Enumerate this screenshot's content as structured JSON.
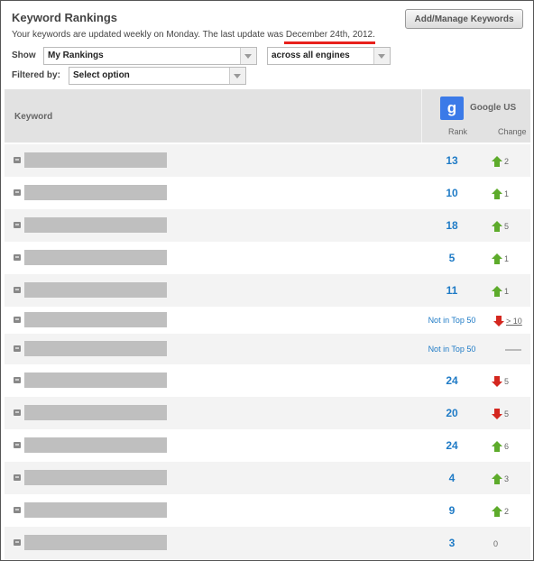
{
  "header": {
    "title": "Keyword Rankings",
    "subtitle_prefix": "Your keywords are updated weekly on Monday. The last update was ",
    "last_update": "December 24th, 2012",
    "subtitle_suffix": ".",
    "manage_button": "Add/Manage Keywords"
  },
  "filters": {
    "show_label": "Show",
    "show_value": "My Rankings",
    "engine_value": "across all engines",
    "filtered_label": "Filtered by:",
    "filtered_value": "Select option"
  },
  "table": {
    "keyword_header": "Keyword",
    "engine": {
      "logo": "g",
      "name": "Google US"
    },
    "rank_header": "Rank",
    "change_header": "Change",
    "rows": [
      {
        "rank": "13",
        "direction": "up",
        "change": "2"
      },
      {
        "rank": "10",
        "direction": "up",
        "change": "1"
      },
      {
        "rank": "18",
        "direction": "up",
        "change": "5"
      },
      {
        "rank": "5",
        "direction": "up",
        "change": "1"
      },
      {
        "rank": "11",
        "direction": "up",
        "change": "1"
      },
      {
        "rank": "Not in Top 50",
        "direction": "down",
        "change": "> 10"
      },
      {
        "rank": "Not in Top 50",
        "direction": "none",
        "change": ""
      },
      {
        "rank": "24",
        "direction": "down",
        "change": "5"
      },
      {
        "rank": "20",
        "direction": "down",
        "change": "5"
      },
      {
        "rank": "24",
        "direction": "up",
        "change": "6"
      },
      {
        "rank": "4",
        "direction": "up",
        "change": "3"
      },
      {
        "rank": "9",
        "direction": "up",
        "change": "2"
      },
      {
        "rank": "3",
        "direction": "zero",
        "change": "0"
      }
    ]
  },
  "colors": {
    "accent_blue": "#1f7bc6",
    "up_green": "#5dab2b",
    "down_red": "#d4271f",
    "underline_red": "#e8201b",
    "google_blue": "#3b7ae8"
  }
}
